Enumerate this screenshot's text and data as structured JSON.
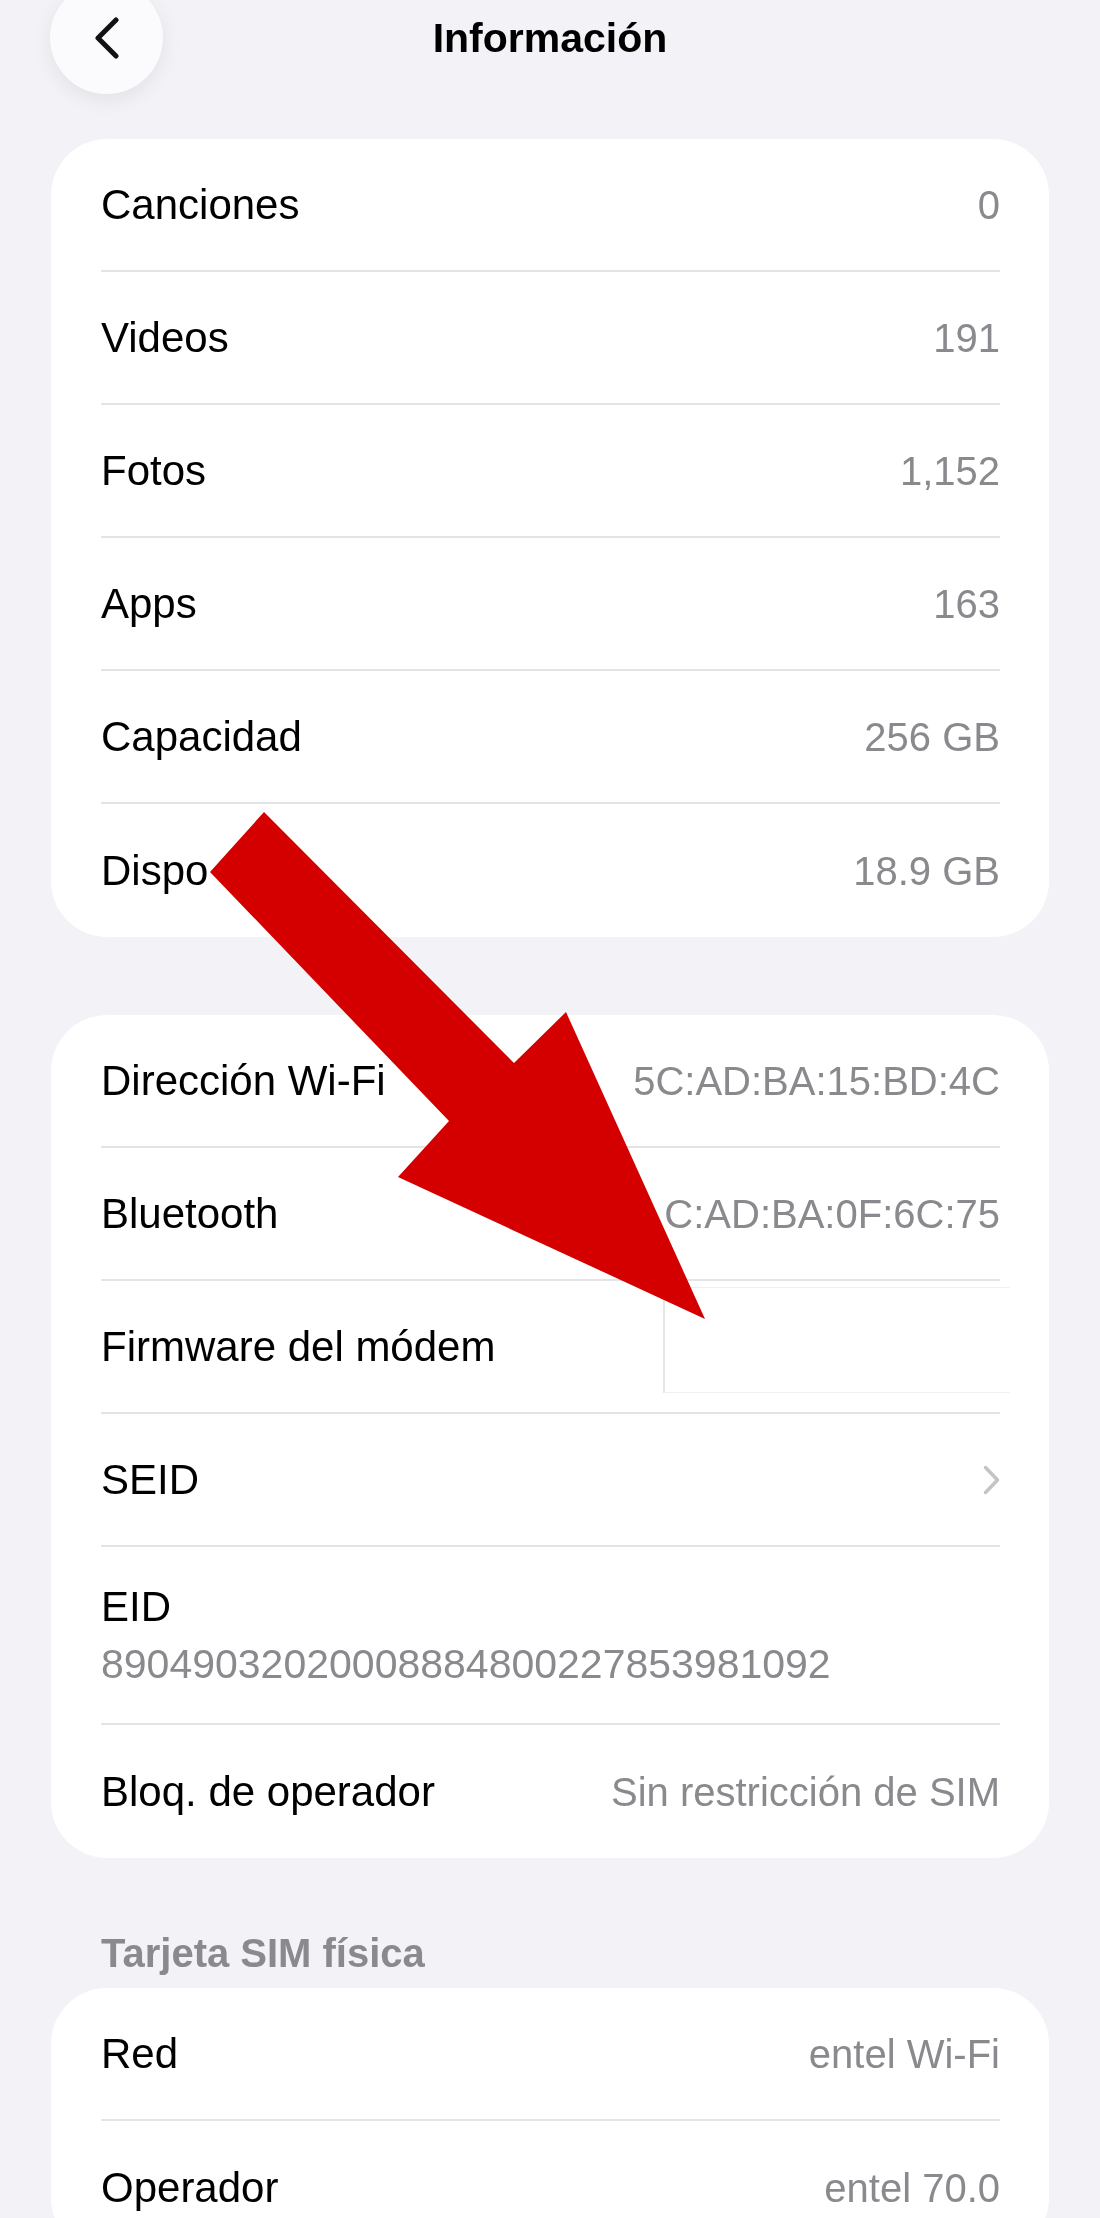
{
  "nav": {
    "title": "Información"
  },
  "sections": [
    {
      "rows": [
        {
          "kind": "value",
          "label": "Canciones",
          "value": "0"
        },
        {
          "kind": "value",
          "label": "Videos",
          "value": "191"
        },
        {
          "kind": "value",
          "label": "Fotos",
          "value": "1,152"
        },
        {
          "kind": "value",
          "label": "Apps",
          "value": "163"
        },
        {
          "kind": "value",
          "label": "Capacidad",
          "value": "256 GB"
        },
        {
          "kind": "value",
          "label": "Dispo",
          "value": "18.9 GB"
        }
      ]
    },
    {
      "rows": [
        {
          "kind": "value",
          "label": "Dirección Wi-Fi",
          "value": "5C:AD:BA:15:BD:4C"
        },
        {
          "kind": "value",
          "label": "Bluetooth",
          "value": "C:AD:BA:0F:6C:75"
        },
        {
          "kind": "redacted",
          "label": "Firmware del módem"
        },
        {
          "kind": "link",
          "label": "SEID"
        },
        {
          "kind": "stacked",
          "label": "EID",
          "value": "89049032020008884800227853981092"
        },
        {
          "kind": "value",
          "label": "Bloq. de operador",
          "value": "Sin restricción de SIM"
        }
      ]
    },
    {
      "header": "Tarjeta SIM física",
      "rows": [
        {
          "kind": "value",
          "label": "Red",
          "value": "entel Wi-Fi"
        },
        {
          "kind": "value",
          "label": "Operador",
          "value": "entel 70.0"
        }
      ]
    }
  ],
  "overlay": {
    "kind": "arrow"
  }
}
